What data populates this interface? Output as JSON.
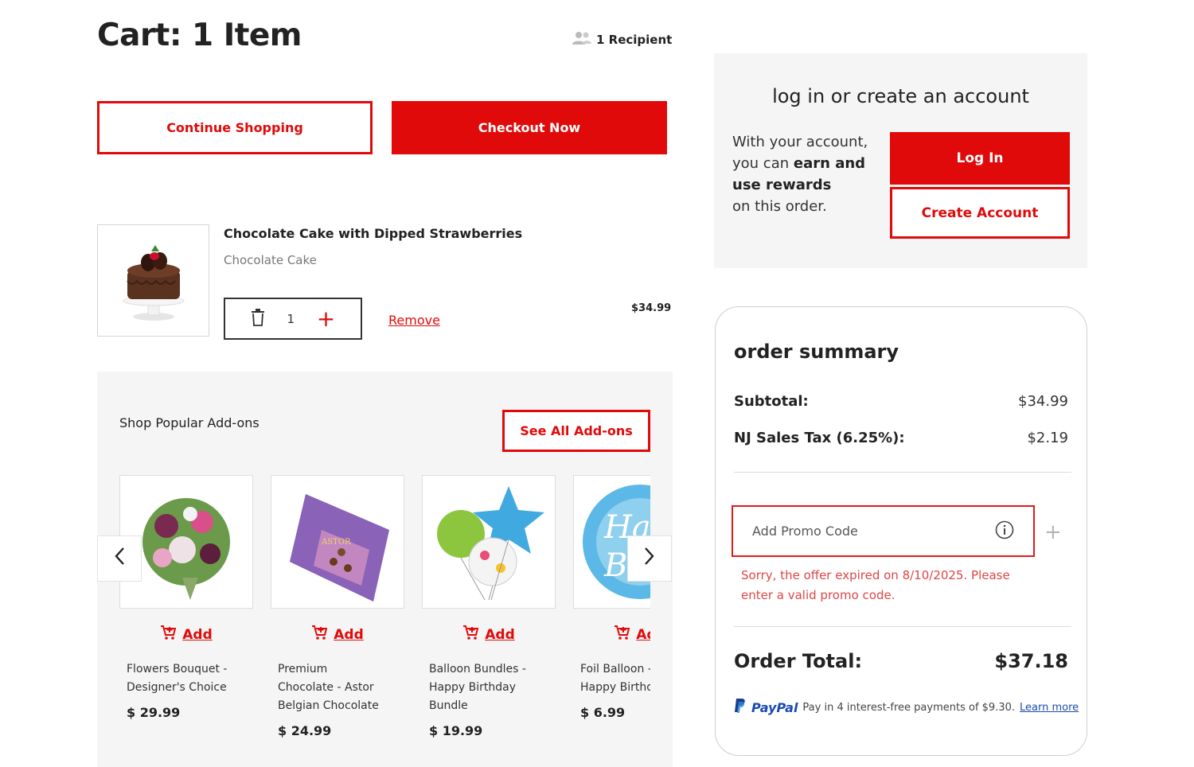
{
  "header": {
    "title": "Cart: 1 Item",
    "recipient": "1 Recipient"
  },
  "actions": {
    "continue_label": "Continue Shopping",
    "checkout_label": "Checkout Now"
  },
  "cart_item": {
    "name": "Chocolate Cake with Dipped Strawberries",
    "subtitle": "Chocolate Cake",
    "quantity": "1",
    "remove_label": "Remove",
    "price": "$34.99"
  },
  "addons": {
    "title": "Shop Popular Add-ons",
    "see_all_label": "See All Add-ons",
    "add_label": "Add",
    "items": [
      {
        "name": "Flowers Bouquet - Designer's Choice",
        "price": "$ 29.99"
      },
      {
        "name": "Premium Chocolate - Astor Belgian Chocolate",
        "price": "$ 24.99"
      },
      {
        "name": "Balloon Bundles - Happy Birthday Bundle",
        "price": "$ 19.99"
      },
      {
        "name": "Foil Balloon - Happy Birthday",
        "price": "$ 6.99"
      }
    ]
  },
  "login": {
    "title": "log in or create an account",
    "desc_line1": "With your account, you can",
    "desc_bold": "earn and use rewards",
    "desc_line3": "on this order.",
    "login_label": "Log In",
    "create_label": "Create Account"
  },
  "summary": {
    "title": "order summary",
    "subtotal_label": "Subtotal:",
    "subtotal_value": "$34.99",
    "tax_label": "NJ Sales Tax (6.25%):",
    "tax_value": "$2.19",
    "promo_placeholder": "Add Promo Code",
    "promo_error": "Sorry, the offer expired on 8/10/2025. Please enter a valid promo code.",
    "total_label": "Order Total:",
    "total_value": "$37.18",
    "paypal_brand": "PayPal",
    "paypal_text": "Pay in 4 interest-free payments of $9.30.",
    "paypal_learn": "Learn more"
  },
  "colors": {
    "accent": "#e10a0a",
    "panel_bg": "#f5f5f5"
  }
}
